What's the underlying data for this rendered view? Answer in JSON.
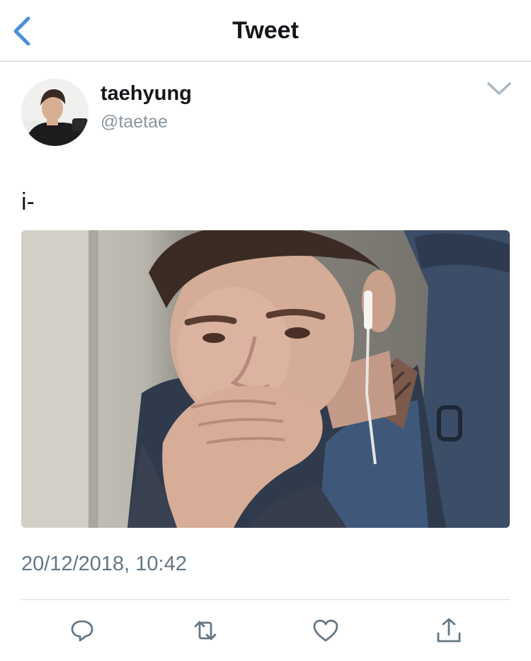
{
  "header": {
    "title": "Tweet",
    "back_icon": "chevron-left-icon",
    "accent_color": "#4a90d9"
  },
  "tweet": {
    "display_name": "taehyung",
    "handle": "@taetae",
    "text": "i-",
    "timestamp": "20/12/2018, 10:42",
    "menu_icon": "chevron-down-icon"
  },
  "actions": [
    {
      "icon": "reply-icon"
    },
    {
      "icon": "retweet-icon"
    },
    {
      "icon": "like-icon"
    },
    {
      "icon": "share-icon"
    }
  ],
  "colors": {
    "text_primary": "#14171a",
    "text_secondary": "#657786",
    "icon_gray": "#657786",
    "divider": "#d7dbdf"
  }
}
